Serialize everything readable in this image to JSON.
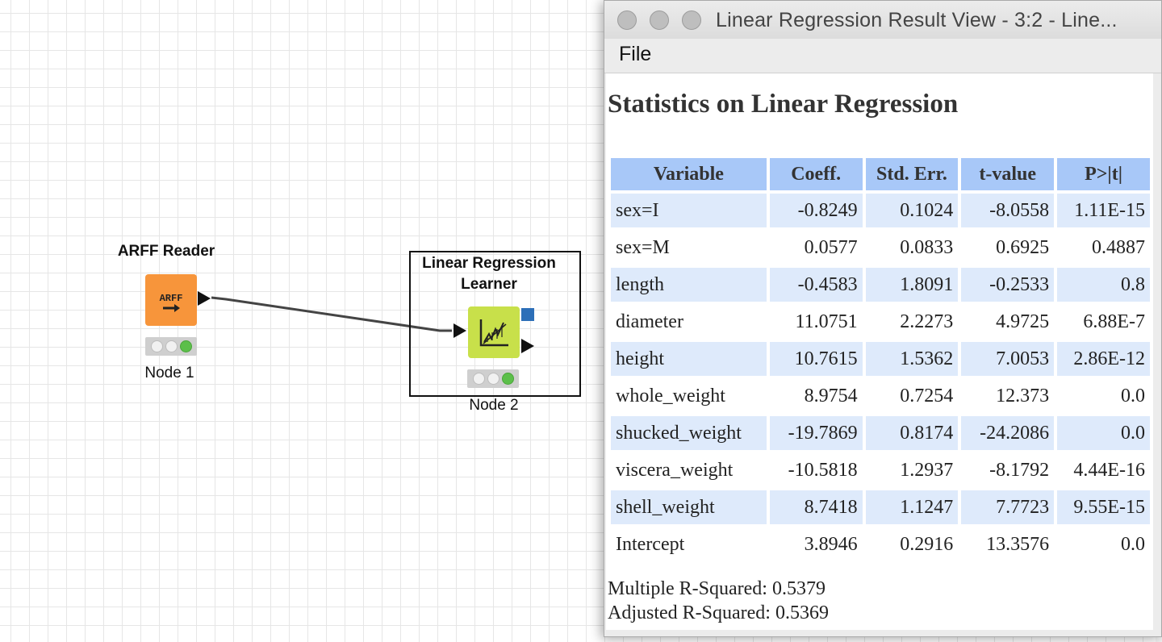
{
  "workflow": {
    "nodes": [
      {
        "title": "ARFF Reader",
        "label": "Node 1",
        "icon": "arff-reader-icon",
        "color": "#f7953b"
      },
      {
        "title": "Linear Regression Learner",
        "label": "Node 2",
        "icon": "regression-chart-icon",
        "color": "#c8e04a"
      }
    ]
  },
  "window": {
    "title": "Linear Regression Result View - 3:2 - Line...",
    "menu": {
      "file": "File"
    }
  },
  "report": {
    "heading": "Statistics on Linear Regression",
    "columns": [
      "Variable",
      "Coeff.",
      "Std. Err.",
      "t-value",
      "P>|t|"
    ],
    "rows": [
      [
        "sex=I",
        "-0.8249",
        "0.1024",
        "-8.0558",
        "1.11E-15"
      ],
      [
        "sex=M",
        "0.0577",
        "0.0833",
        "0.6925",
        "0.4887"
      ],
      [
        "length",
        "-0.4583",
        "1.8091",
        "-0.2533",
        "0.8"
      ],
      [
        "diameter",
        "11.0751",
        "2.2273",
        "4.9725",
        "6.88E-7"
      ],
      [
        "height",
        "10.7615",
        "1.5362",
        "7.0053",
        "2.86E-12"
      ],
      [
        "whole_weight",
        "8.9754",
        "0.7254",
        "12.373",
        "0.0"
      ],
      [
        "shucked_weight",
        "-19.7869",
        "0.8174",
        "-24.2086",
        "0.0"
      ],
      [
        "viscera_weight",
        "-10.5818",
        "1.2937",
        "-8.1792",
        "4.44E-16"
      ],
      [
        "shell_weight",
        "8.7418",
        "1.1247",
        "7.7723",
        "9.55E-15"
      ],
      [
        "Intercept",
        "3.8946",
        "0.2916",
        "13.3576",
        "0.0"
      ]
    ],
    "multiple_r_squared": "Multiple R-Squared: 0.5379",
    "adjusted_r_squared": "Adjusted R-Squared: 0.5369"
  },
  "colors": {
    "header_bg": "#a8c8f8",
    "alt_row_bg": "#deeafb",
    "status_ok": "#5cbf4a"
  }
}
